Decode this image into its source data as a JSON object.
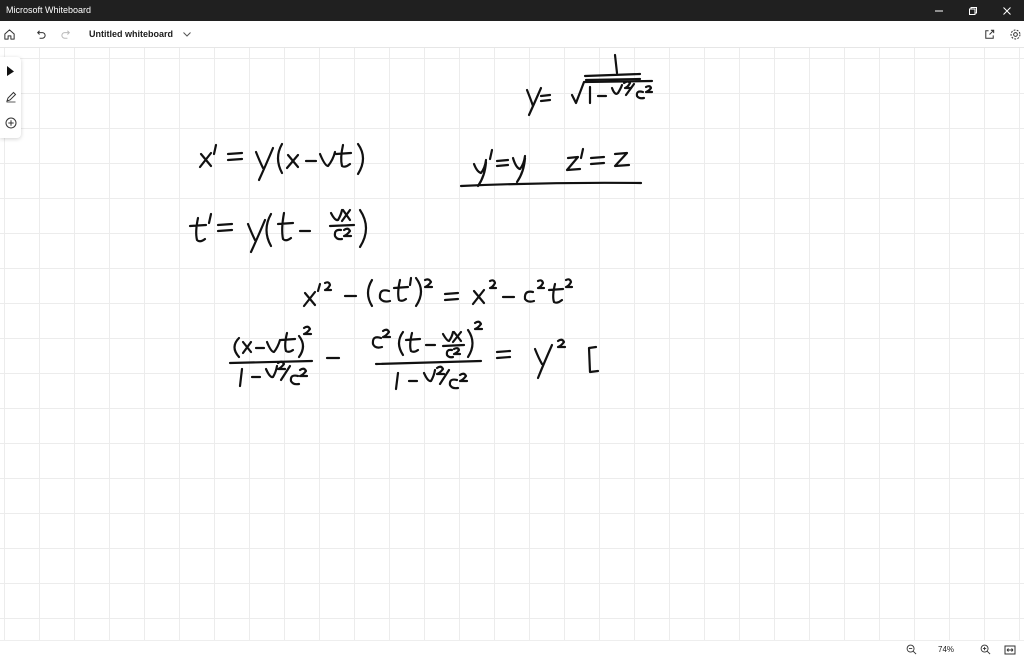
{
  "window": {
    "app_title": "Microsoft Whiteboard",
    "controls": [
      "minimize",
      "restore",
      "close"
    ]
  },
  "toolbar": {
    "board_title": "Untitled whiteboard",
    "left_icons": [
      "home-icon",
      "undo-icon",
      "redo-icon"
    ],
    "right_icons": [
      "share-icon",
      "settings-icon"
    ]
  },
  "side_tools": [
    "select-icon",
    "pen-icon",
    "add-icon"
  ],
  "status": {
    "zoom_level": "74%",
    "icons": [
      "zoom-out-icon",
      "zoom-in-icon",
      "fit-to-screen-icon"
    ]
  },
  "handwriting": {
    "gamma_definition": "γ = 1 / √(1 − v²/c²)",
    "x_transform": "x′ = γ(x − vt)",
    "t_transform": "t′ = γ(t − vx/c²)",
    "yz_transform": "y′ = y    z′ = z",
    "interval": "x′² − (ct′)² = x² − c²t²",
    "expansion": "(x − vt)² / (1 − v²/c²) − c²(t − vx/c²)² / (1 − v²/c²) = γ² ["
  },
  "colors": {
    "titlebar_bg": "#202020",
    "ink": "#111111",
    "grid": "#ececec",
    "accent": "#1b1b1b"
  }
}
